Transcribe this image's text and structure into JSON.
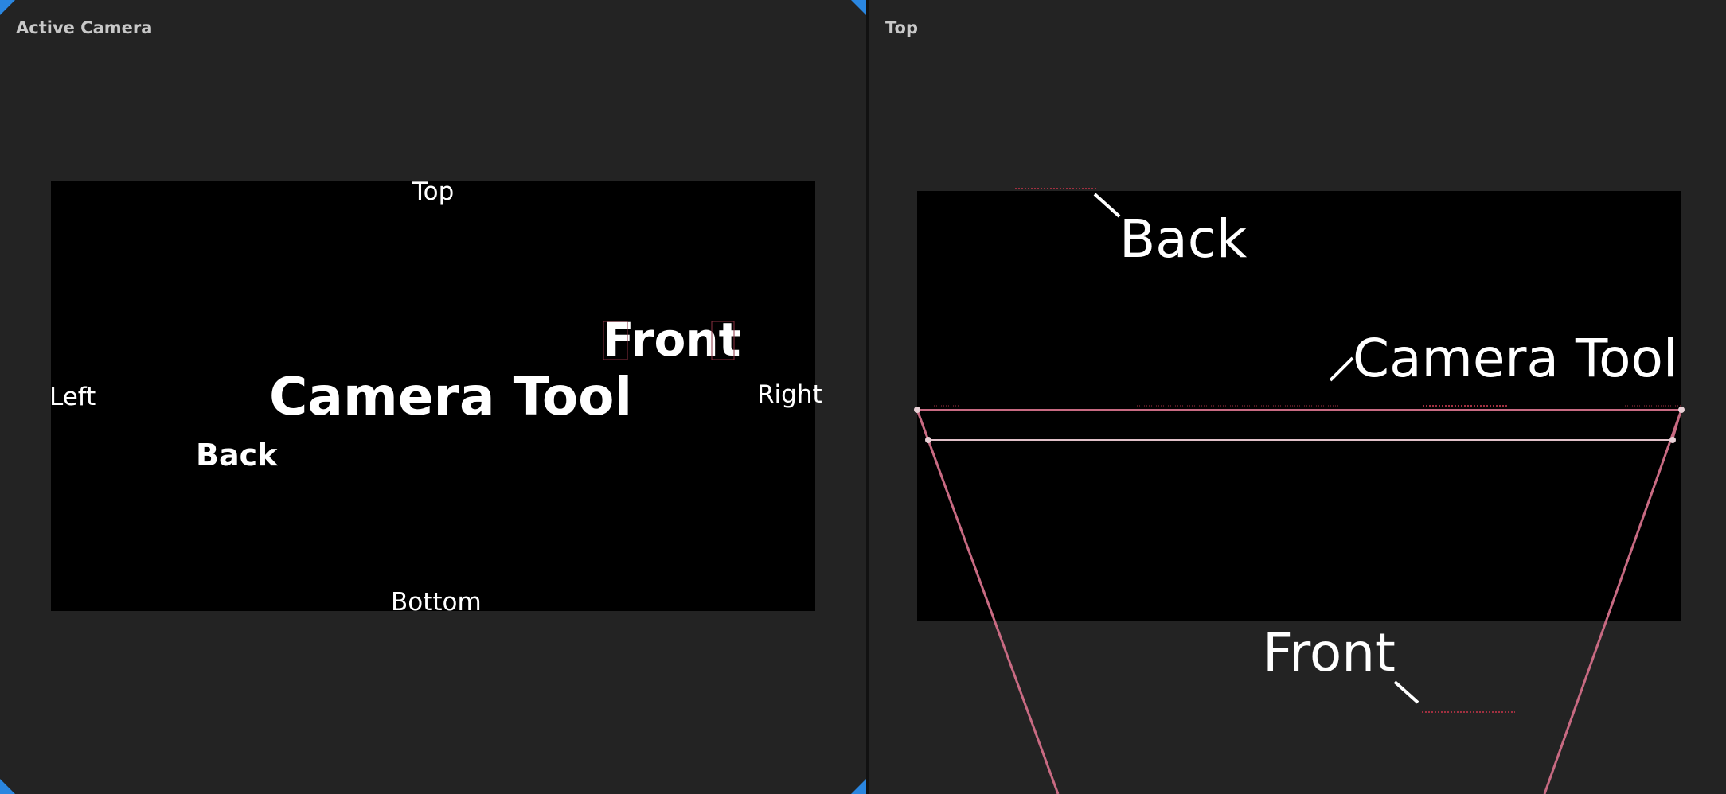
{
  "left_viewport": {
    "title": "Active Camera",
    "labels": {
      "top": "Top",
      "left": "Left",
      "right": "Right",
      "bottom": "Bottom",
      "title": "Camera Tool",
      "front": "Front",
      "back": "Back"
    }
  },
  "right_viewport": {
    "title": "Top",
    "labels": {
      "back": "Back",
      "title": "Camera Tool",
      "front": "Front"
    }
  },
  "colors": {
    "panel_bg": "#232323",
    "screen_bg": "#000000",
    "corner_accent": "#2a86e0",
    "frustum": "#c86a82",
    "text": "#ffffff",
    "title_text": "#c8c8c8"
  }
}
